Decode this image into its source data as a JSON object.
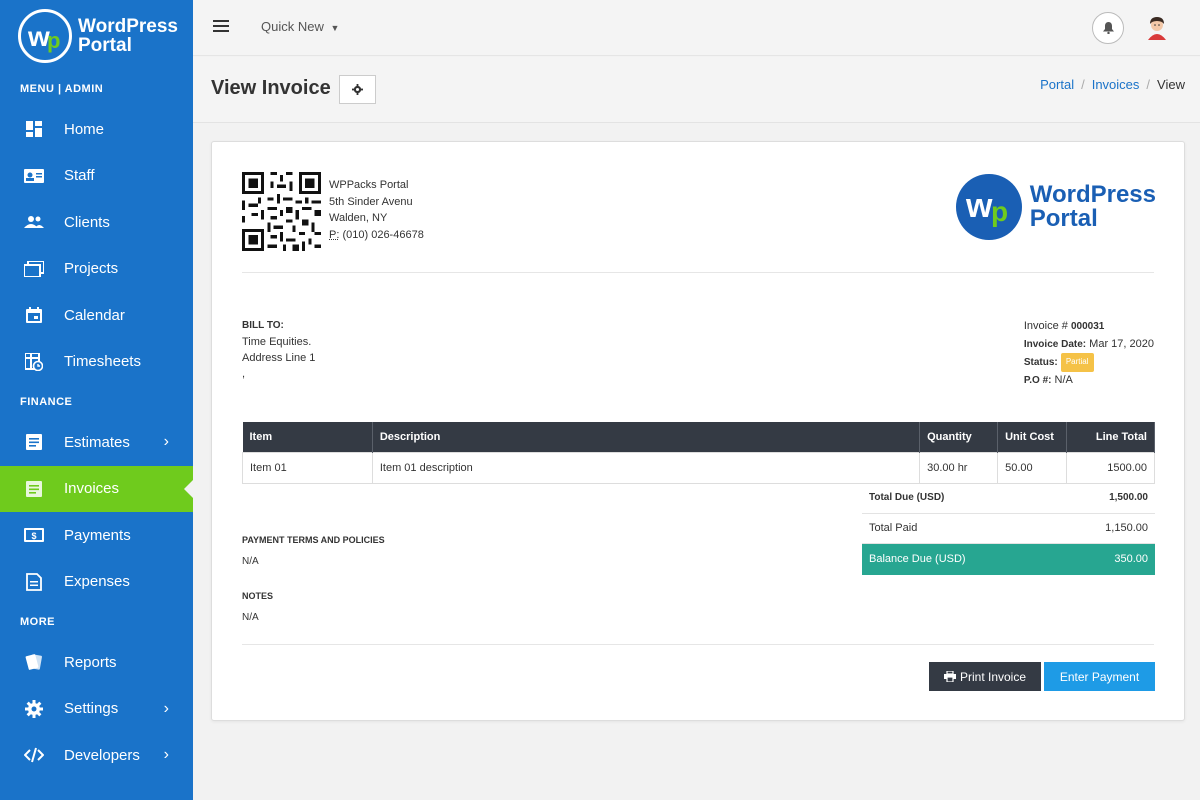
{
  "app": {
    "brand_line1": "WordPress",
    "brand_line2": "Portal"
  },
  "sidebar": {
    "menu_label": "MENU | ADMIN",
    "main_items": [
      {
        "label": "Home",
        "icon": "dashboard-icon"
      },
      {
        "label": "Staff",
        "icon": "id-card-icon"
      },
      {
        "label": "Clients",
        "icon": "users-icon"
      },
      {
        "label": "Projects",
        "icon": "folders-icon"
      },
      {
        "label": "Calendar",
        "icon": "calendar-icon"
      },
      {
        "label": "Timesheets",
        "icon": "timesheet-icon"
      }
    ],
    "finance_label": "FINANCE",
    "finance_items": [
      {
        "label": "Estimates",
        "icon": "document-icon"
      },
      {
        "label": "Invoices",
        "icon": "invoice-icon"
      },
      {
        "label": "Payments",
        "icon": "money-icon"
      },
      {
        "label": "Expenses",
        "icon": "receipt-icon"
      }
    ],
    "more_label": "MORE",
    "more_items": [
      {
        "label": "Reports",
        "icon": "reports-icon"
      },
      {
        "label": "Settings",
        "icon": "gear-icon"
      },
      {
        "label": "Developers",
        "icon": "code-icon"
      }
    ],
    "active_color": "#6fcb1d",
    "bg_color": "#1a73c9"
  },
  "topbar": {
    "quick_new": "Quick New"
  },
  "header": {
    "title": "View Invoice",
    "breadcrumb": [
      "Portal",
      "Invoices",
      "View"
    ]
  },
  "invoice": {
    "company": {
      "name": "WPPacks Portal",
      "address1": "5th Sinder Avenu",
      "address2": "Walden, NY",
      "phone_label": "P:",
      "phone": "(010) 026-46678"
    },
    "logo_line1": "WordPress",
    "logo_line2": "Portal",
    "bill_to": {
      "label": "BILL TO:",
      "name": "Time Equities.",
      "address": "Address Line 1",
      "extra": ","
    },
    "meta": {
      "number_label": "Invoice #",
      "number": "000031",
      "date_label": "Invoice Date:",
      "date": "Mar 17, 2020",
      "status_label": "Status:",
      "status": "Partial",
      "po_label": "P.O #:",
      "po": "N/A"
    },
    "table": {
      "headers": [
        "Item",
        "Description",
        "Quantity",
        "Unit Cost",
        "Line Total"
      ],
      "rows": [
        [
          "Item 01",
          "Item 01 description",
          "30.00 hr",
          "50.00",
          "1500.00"
        ]
      ]
    },
    "totals": {
      "due_label": "Total Due (USD)",
      "due": "1,500.00",
      "paid_label": "Total Paid",
      "paid": "1,150.00",
      "balance_label": "Balance Due (USD)",
      "balance": "350.00"
    },
    "terms_label": "PAYMENT TERMS AND POLICIES",
    "terms_value": "N/A",
    "notes_label": "NOTES",
    "notes_value": "N/A",
    "print_label": "Print Invoice",
    "pay_label": "Enter Payment"
  }
}
